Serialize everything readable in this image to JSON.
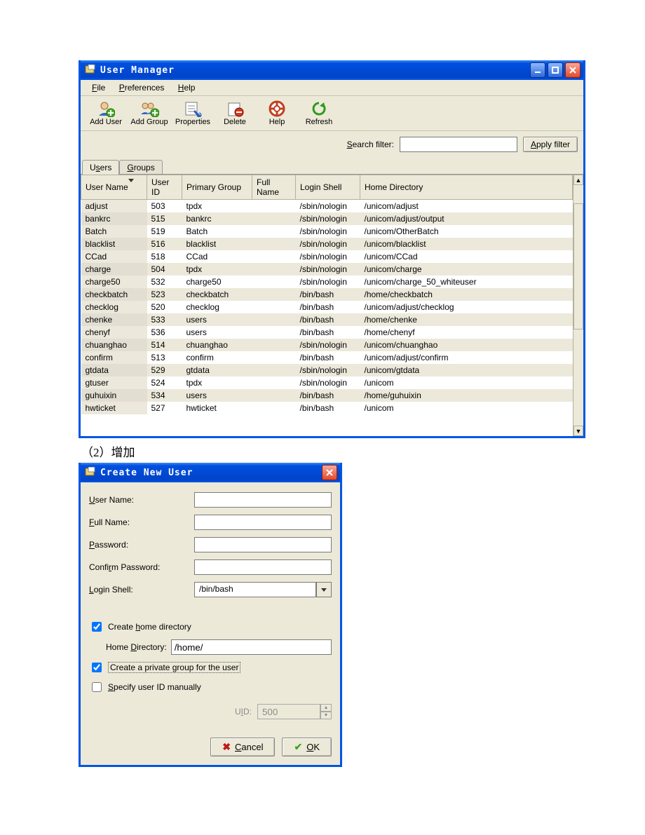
{
  "main": {
    "title": "User Manager",
    "menu": {
      "file": "File",
      "file_u": "F",
      "prefs": "Preferences",
      "prefs_u": "P",
      "help": "Help",
      "help_u": "H"
    },
    "toolbar": {
      "add_user": "Add User",
      "add_group": "Add Group",
      "properties": "Properties",
      "delete": "Delete",
      "help": "Help",
      "refresh": "Refresh"
    },
    "filter": {
      "label": "Search filter:",
      "apply": "Apply filter",
      "s_u": "S",
      "a_u": "A"
    },
    "tabs": {
      "users": "Users",
      "users_u": "s",
      "groups": "Groups",
      "groups_u": "G"
    },
    "columns": {
      "user_name": "User Name",
      "user_id": "User ID",
      "primary_group": "Primary Group",
      "full_name": "Full Name",
      "login_shell": "Login Shell",
      "home": "Home Directory"
    },
    "rows": [
      {
        "name": "adjust",
        "uid": "503",
        "grp": "tpdx",
        "full": "",
        "shell": "/sbin/nologin",
        "home": "/unicom/adjust"
      },
      {
        "name": "bankrc",
        "uid": "515",
        "grp": "bankrc",
        "full": "",
        "shell": "/sbin/nologin",
        "home": "/unicom/adjust/output"
      },
      {
        "name": "Batch",
        "uid": "519",
        "grp": "Batch",
        "full": "",
        "shell": "/sbin/nologin",
        "home": "/unicom/OtherBatch"
      },
      {
        "name": "blacklist",
        "uid": "516",
        "grp": "blacklist",
        "full": "",
        "shell": "/sbin/nologin",
        "home": "/unicom/blacklist"
      },
      {
        "name": "CCad",
        "uid": "518",
        "grp": "CCad",
        "full": "",
        "shell": "/sbin/nologin",
        "home": "/unicom/CCad"
      },
      {
        "name": "charge",
        "uid": "504",
        "grp": "tpdx",
        "full": "",
        "shell": "/sbin/nologin",
        "home": "/unicom/charge"
      },
      {
        "name": "charge50",
        "uid": "532",
        "grp": "charge50",
        "full": "",
        "shell": "/sbin/nologin",
        "home": "/unicom/charge_50_whiteuser"
      },
      {
        "name": "checkbatch",
        "uid": "523",
        "grp": "checkbatch",
        "full": "",
        "shell": "/bin/bash",
        "home": "/home/checkbatch"
      },
      {
        "name": "checklog",
        "uid": "520",
        "grp": "checklog",
        "full": "",
        "shell": "/bin/bash",
        "home": "/unicom/adjust/checklog"
      },
      {
        "name": "chenke",
        "uid": "533",
        "grp": "users",
        "full": "",
        "shell": "/bin/bash",
        "home": "/home/chenke"
      },
      {
        "name": "chenyf",
        "uid": "536",
        "grp": "users",
        "full": "",
        "shell": "/bin/bash",
        "home": "/home/chenyf"
      },
      {
        "name": "chuanghao",
        "uid": "514",
        "grp": "chuanghao",
        "full": "",
        "shell": "/sbin/nologin",
        "home": "/unicom/chuanghao"
      },
      {
        "name": "confirm",
        "uid": "513",
        "grp": "confirm",
        "full": "",
        "shell": "/bin/bash",
        "home": "/unicom/adjust/confirm"
      },
      {
        "name": "gtdata",
        "uid": "529",
        "grp": "gtdata",
        "full": "",
        "shell": "/sbin/nologin",
        "home": "/unicom/gtdata"
      },
      {
        "name": "gtuser",
        "uid": "524",
        "grp": "tpdx",
        "full": "",
        "shell": "/sbin/nologin",
        "home": "/unicom"
      },
      {
        "name": "guhuixin",
        "uid": "534",
        "grp": "users",
        "full": "",
        "shell": "/bin/bash",
        "home": "/home/guhuixin"
      },
      {
        "name": "hwticket",
        "uid": "527",
        "grp": "hwticket",
        "full": "",
        "shell": "/bin/bash",
        "home": "/unicom"
      }
    ]
  },
  "caption": "（2）增加",
  "dialog": {
    "title": "Create New User",
    "labels": {
      "user_name": "User Name:",
      "full_name": "Full Name:",
      "password": "Password:",
      "confirm": "Confirm Password:",
      "login_shell": "Login Shell:",
      "home_dir": "Home Directory:",
      "uid": "UID:"
    },
    "ul": {
      "u": "U",
      "f": "F",
      "p": "P",
      "r": "r",
      "l": "L",
      "h": "h",
      "d": "D",
      "g": "g",
      "s": "S",
      "i": "I",
      "c": "C",
      "o": "O"
    },
    "login_shell_value": "/bin/bash",
    "chk_home": "Create home directory",
    "home_value": "/home/",
    "chk_group": "Create a private group for the user",
    "chk_uid": "Specify user ID manually",
    "uid_value": "500",
    "cancel": "Cancel",
    "ok": "OK"
  }
}
